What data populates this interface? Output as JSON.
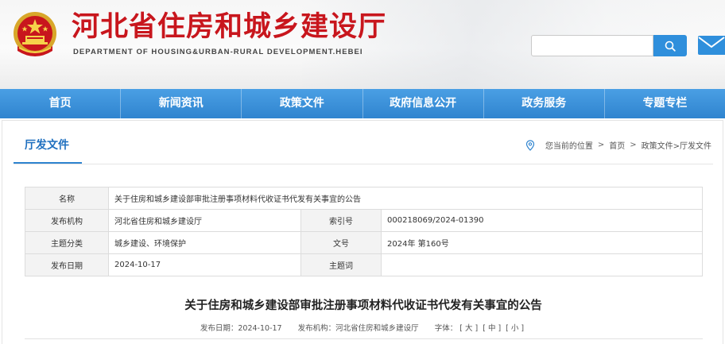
{
  "header": {
    "title": "河北省住房和城乡建设厅",
    "subtitle": "DEPARTMENT OF HOUSING&URBAN-RURAL DEVELOPMENT.HEBEI",
    "emblem_icon": "national-emblem-icon",
    "search": {
      "value": "",
      "icon": "search-icon"
    },
    "mail_icon": "mail-icon",
    "title_color": "#c8161d"
  },
  "nav": {
    "items": [
      "首页",
      "新闻资讯",
      "政策文件",
      "政府信息公开",
      "政务服务",
      "专题专栏"
    ],
    "color": "#3a90d8"
  },
  "section": {
    "tab_label": "厅发文件"
  },
  "breadcrumb": {
    "icon": "location-pin-icon",
    "prefix": "您当前的位置",
    "items": [
      "首页",
      "政策文件>厅发文件"
    ],
    "separator": ">"
  },
  "meta": {
    "name_label": "名称",
    "name_value": "关于住房和城乡建设部审批注册事项材料代收证书代发有关事宜的公告",
    "publisher_label": "发布机构",
    "publisher_value": "河北省住房和城乡建设厅",
    "index_label": "索引号",
    "index_value": "000218069/2024-01390",
    "category_label": "主题分类",
    "category_value": "城乡建设、环境保护",
    "docno_label": "文号",
    "docno_value": "2024年 第160号",
    "date_label": "发布日期",
    "date_value": "2024-10-17",
    "keywords_label": "主题词",
    "keywords_value": ""
  },
  "article": {
    "title": "关于住房和城乡建设部审批注册事项材料代收证书代发有关事宜的公告",
    "date_label": "发布日期：",
    "date_value": "2024-10-17",
    "publisher_label": "发布机构：",
    "publisher_value": "河北省住房和城乡建设厅",
    "font_label": "字体：",
    "font_large": "[ 大 ]",
    "font_medium": "[ 中 ]",
    "font_small": "[ 小 ]"
  }
}
